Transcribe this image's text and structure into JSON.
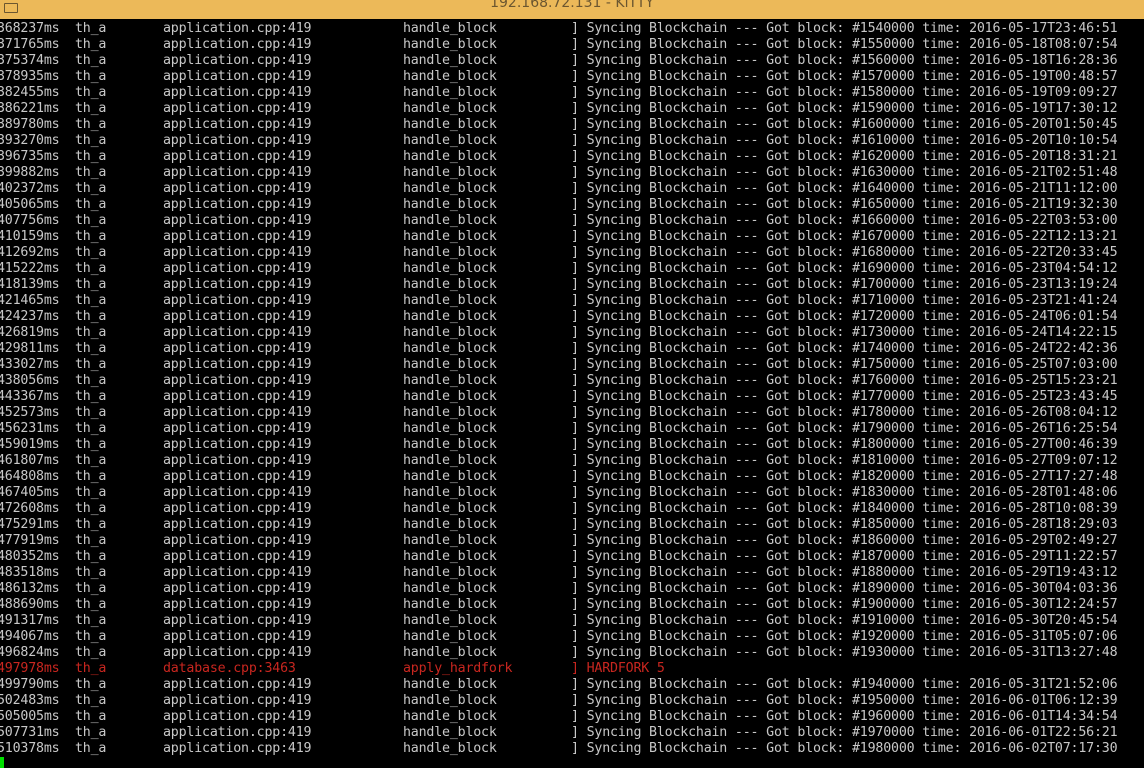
{
  "window": {
    "title": "192.168.72.131 - KiTTY"
  },
  "log_lines": [
    {
      "ts": "368237ms",
      "thread": "th_a",
      "file": "application.cpp:419",
      "func": "handle_block",
      "msg": "] Syncing Blockchain --- Got block: #1540000 time: 2016-05-17T23:46:51",
      "red": false
    },
    {
      "ts": "371765ms",
      "thread": "th_a",
      "file": "application.cpp:419",
      "func": "handle_block",
      "msg": "] Syncing Blockchain --- Got block: #1550000 time: 2016-05-18T08:07:54",
      "red": false
    },
    {
      "ts": "375374ms",
      "thread": "th_a",
      "file": "application.cpp:419",
      "func": "handle_block",
      "msg": "] Syncing Blockchain --- Got block: #1560000 time: 2016-05-18T16:28:36",
      "red": false
    },
    {
      "ts": "378935ms",
      "thread": "th_a",
      "file": "application.cpp:419",
      "func": "handle_block",
      "msg": "] Syncing Blockchain --- Got block: #1570000 time: 2016-05-19T00:48:57",
      "red": false
    },
    {
      "ts": "382455ms",
      "thread": "th_a",
      "file": "application.cpp:419",
      "func": "handle_block",
      "msg": "] Syncing Blockchain --- Got block: #1580000 time: 2016-05-19T09:09:27",
      "red": false
    },
    {
      "ts": "386221ms",
      "thread": "th_a",
      "file": "application.cpp:419",
      "func": "handle_block",
      "msg": "] Syncing Blockchain --- Got block: #1590000 time: 2016-05-19T17:30:12",
      "red": false
    },
    {
      "ts": "389780ms",
      "thread": "th_a",
      "file": "application.cpp:419",
      "func": "handle_block",
      "msg": "] Syncing Blockchain --- Got block: #1600000 time: 2016-05-20T01:50:45",
      "red": false
    },
    {
      "ts": "393270ms",
      "thread": "th_a",
      "file": "application.cpp:419",
      "func": "handle_block",
      "msg": "] Syncing Blockchain --- Got block: #1610000 time: 2016-05-20T10:10:54",
      "red": false
    },
    {
      "ts": "396735ms",
      "thread": "th_a",
      "file": "application.cpp:419",
      "func": "handle_block",
      "msg": "] Syncing Blockchain --- Got block: #1620000 time: 2016-05-20T18:31:21",
      "red": false
    },
    {
      "ts": "399882ms",
      "thread": "th_a",
      "file": "application.cpp:419",
      "func": "handle_block",
      "msg": "] Syncing Blockchain --- Got block: #1630000 time: 2016-05-21T02:51:48",
      "red": false
    },
    {
      "ts": "402372ms",
      "thread": "th_a",
      "file": "application.cpp:419",
      "func": "handle_block",
      "msg": "] Syncing Blockchain --- Got block: #1640000 time: 2016-05-21T11:12:00",
      "red": false
    },
    {
      "ts": "405065ms",
      "thread": "th_a",
      "file": "application.cpp:419",
      "func": "handle_block",
      "msg": "] Syncing Blockchain --- Got block: #1650000 time: 2016-05-21T19:32:30",
      "red": false
    },
    {
      "ts": "407756ms",
      "thread": "th_a",
      "file": "application.cpp:419",
      "func": "handle_block",
      "msg": "] Syncing Blockchain --- Got block: #1660000 time: 2016-05-22T03:53:00",
      "red": false
    },
    {
      "ts": "410159ms",
      "thread": "th_a",
      "file": "application.cpp:419",
      "func": "handle_block",
      "msg": "] Syncing Blockchain --- Got block: #1670000 time: 2016-05-22T12:13:21",
      "red": false
    },
    {
      "ts": "412692ms",
      "thread": "th_a",
      "file": "application.cpp:419",
      "func": "handle_block",
      "msg": "] Syncing Blockchain --- Got block: #1680000 time: 2016-05-22T20:33:45",
      "red": false
    },
    {
      "ts": "415222ms",
      "thread": "th_a",
      "file": "application.cpp:419",
      "func": "handle_block",
      "msg": "] Syncing Blockchain --- Got block: #1690000 time: 2016-05-23T04:54:12",
      "red": false
    },
    {
      "ts": "418139ms",
      "thread": "th_a",
      "file": "application.cpp:419",
      "func": "handle_block",
      "msg": "] Syncing Blockchain --- Got block: #1700000 time: 2016-05-23T13:19:24",
      "red": false
    },
    {
      "ts": "421465ms",
      "thread": "th_a",
      "file": "application.cpp:419",
      "func": "handle_block",
      "msg": "] Syncing Blockchain --- Got block: #1710000 time: 2016-05-23T21:41:24",
      "red": false
    },
    {
      "ts": "424237ms",
      "thread": "th_a",
      "file": "application.cpp:419",
      "func": "handle_block",
      "msg": "] Syncing Blockchain --- Got block: #1720000 time: 2016-05-24T06:01:54",
      "red": false
    },
    {
      "ts": "426819ms",
      "thread": "th_a",
      "file": "application.cpp:419",
      "func": "handle_block",
      "msg": "] Syncing Blockchain --- Got block: #1730000 time: 2016-05-24T14:22:15",
      "red": false
    },
    {
      "ts": "429811ms",
      "thread": "th_a",
      "file": "application.cpp:419",
      "func": "handle_block",
      "msg": "] Syncing Blockchain --- Got block: #1740000 time: 2016-05-24T22:42:36",
      "red": false
    },
    {
      "ts": "433027ms",
      "thread": "th_a",
      "file": "application.cpp:419",
      "func": "handle_block",
      "msg": "] Syncing Blockchain --- Got block: #1750000 time: 2016-05-25T07:03:00",
      "red": false
    },
    {
      "ts": "438056ms",
      "thread": "th_a",
      "file": "application.cpp:419",
      "func": "handle_block",
      "msg": "] Syncing Blockchain --- Got block: #1760000 time: 2016-05-25T15:23:21",
      "red": false
    },
    {
      "ts": "443367ms",
      "thread": "th_a",
      "file": "application.cpp:419",
      "func": "handle_block",
      "msg": "] Syncing Blockchain --- Got block: #1770000 time: 2016-05-25T23:43:45",
      "red": false
    },
    {
      "ts": "452573ms",
      "thread": "th_a",
      "file": "application.cpp:419",
      "func": "handle_block",
      "msg": "] Syncing Blockchain --- Got block: #1780000 time: 2016-05-26T08:04:12",
      "red": false
    },
    {
      "ts": "456231ms",
      "thread": "th_a",
      "file": "application.cpp:419",
      "func": "handle_block",
      "msg": "] Syncing Blockchain --- Got block: #1790000 time: 2016-05-26T16:25:54",
      "red": false
    },
    {
      "ts": "459019ms",
      "thread": "th_a",
      "file": "application.cpp:419",
      "func": "handle_block",
      "msg": "] Syncing Blockchain --- Got block: #1800000 time: 2016-05-27T00:46:39",
      "red": false
    },
    {
      "ts": "461807ms",
      "thread": "th_a",
      "file": "application.cpp:419",
      "func": "handle_block",
      "msg": "] Syncing Blockchain --- Got block: #1810000 time: 2016-05-27T09:07:12",
      "red": false
    },
    {
      "ts": "464808ms",
      "thread": "th_a",
      "file": "application.cpp:419",
      "func": "handle_block",
      "msg": "] Syncing Blockchain --- Got block: #1820000 time: 2016-05-27T17:27:48",
      "red": false
    },
    {
      "ts": "467405ms",
      "thread": "th_a",
      "file": "application.cpp:419",
      "func": "handle_block",
      "msg": "] Syncing Blockchain --- Got block: #1830000 time: 2016-05-28T01:48:06",
      "red": false
    },
    {
      "ts": "472608ms",
      "thread": "th_a",
      "file": "application.cpp:419",
      "func": "handle_block",
      "msg": "] Syncing Blockchain --- Got block: #1840000 time: 2016-05-28T10:08:39",
      "red": false
    },
    {
      "ts": "475291ms",
      "thread": "th_a",
      "file": "application.cpp:419",
      "func": "handle_block",
      "msg": "] Syncing Blockchain --- Got block: #1850000 time: 2016-05-28T18:29:03",
      "red": false
    },
    {
      "ts": "477919ms",
      "thread": "th_a",
      "file": "application.cpp:419",
      "func": "handle_block",
      "msg": "] Syncing Blockchain --- Got block: #1860000 time: 2016-05-29T02:49:27",
      "red": false
    },
    {
      "ts": "480352ms",
      "thread": "th_a",
      "file": "application.cpp:419",
      "func": "handle_block",
      "msg": "] Syncing Blockchain --- Got block: #1870000 time: 2016-05-29T11:22:57",
      "red": false
    },
    {
      "ts": "483518ms",
      "thread": "th_a",
      "file": "application.cpp:419",
      "func": "handle_block",
      "msg": "] Syncing Blockchain --- Got block: #1880000 time: 2016-05-29T19:43:12",
      "red": false
    },
    {
      "ts": "486132ms",
      "thread": "th_a",
      "file": "application.cpp:419",
      "func": "handle_block",
      "msg": "] Syncing Blockchain --- Got block: #1890000 time: 2016-05-30T04:03:36",
      "red": false
    },
    {
      "ts": "488690ms",
      "thread": "th_a",
      "file": "application.cpp:419",
      "func": "handle_block",
      "msg": "] Syncing Blockchain --- Got block: #1900000 time: 2016-05-30T12:24:57",
      "red": false
    },
    {
      "ts": "491317ms",
      "thread": "th_a",
      "file": "application.cpp:419",
      "func": "handle_block",
      "msg": "] Syncing Blockchain --- Got block: #1910000 time: 2016-05-30T20:45:54",
      "red": false
    },
    {
      "ts": "494067ms",
      "thread": "th_a",
      "file": "application.cpp:419",
      "func": "handle_block",
      "msg": "] Syncing Blockchain --- Got block: #1920000 time: 2016-05-31T05:07:06",
      "red": false
    },
    {
      "ts": "496824ms",
      "thread": "th_a",
      "file": "application.cpp:419",
      "func": "handle_block",
      "msg": "] Syncing Blockchain --- Got block: #1930000 time: 2016-05-31T13:27:48",
      "red": false
    },
    {
      "ts": "497978ms",
      "thread": "th_a",
      "file": "database.cpp:3463",
      "func": "apply_hardfork",
      "msg": "] HARDFORK 5",
      "red": true
    },
    {
      "ts": "499790ms",
      "thread": "th_a",
      "file": "application.cpp:419",
      "func": "handle_block",
      "msg": "] Syncing Blockchain --- Got block: #1940000 time: 2016-05-31T21:52:06",
      "red": false
    },
    {
      "ts": "502483ms",
      "thread": "th_a",
      "file": "application.cpp:419",
      "func": "handle_block",
      "msg": "] Syncing Blockchain --- Got block: #1950000 time: 2016-06-01T06:12:39",
      "red": false
    },
    {
      "ts": "505005ms",
      "thread": "th_a",
      "file": "application.cpp:419",
      "func": "handle_block",
      "msg": "] Syncing Blockchain --- Got block: #1960000 time: 2016-06-01T14:34:54",
      "red": false
    },
    {
      "ts": "507731ms",
      "thread": "th_a",
      "file": "application.cpp:419",
      "func": "handle_block",
      "msg": "] Syncing Blockchain --- Got block: #1970000 time: 2016-06-01T22:56:21",
      "red": false
    },
    {
      "ts": "510378ms",
      "thread": "th_a",
      "file": "application.cpp:419",
      "func": "handle_block",
      "msg": "] Syncing Blockchain --- Got block: #1980000 time: 2016-06-02T07:17:30",
      "red": false
    }
  ]
}
